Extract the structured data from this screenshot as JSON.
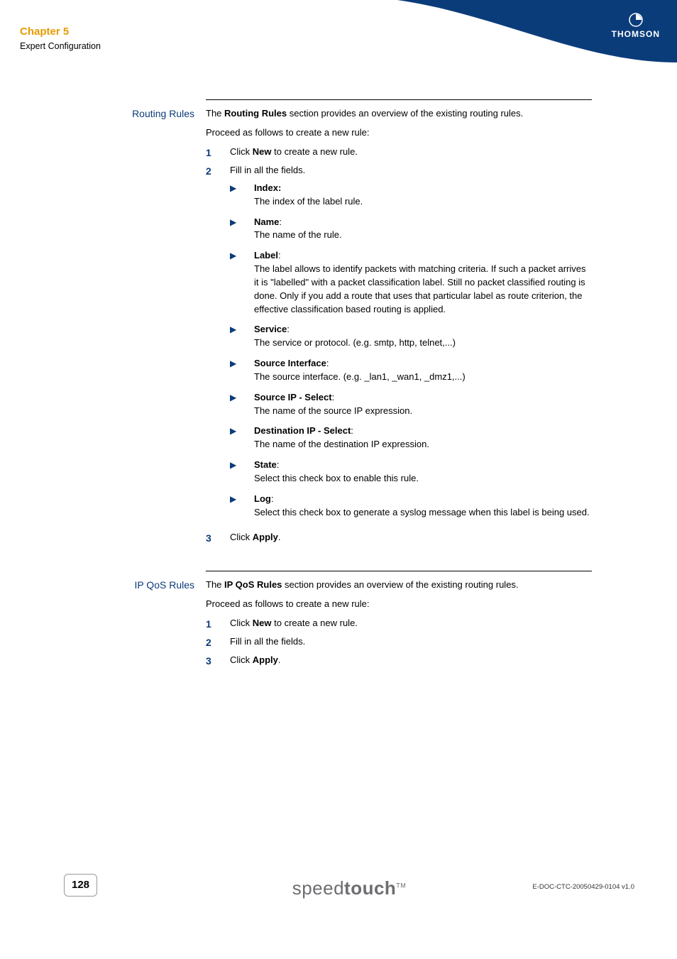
{
  "header": {
    "chapter": "Chapter 5",
    "subtitle": "Expert Configuration",
    "brand": "THOMSON"
  },
  "sections": {
    "routing": {
      "label": "Routing Rules",
      "intro_pre": "The ",
      "intro_bold": "Routing Rules",
      "intro_post": " section provides an overview of the existing routing rules.",
      "proceed": "Proceed as follows to create a new rule:",
      "steps": {
        "s1_pre": "Click ",
        "s1_bold": "New",
        "s1_post": " to create a new rule.",
        "s2": "Fill in all the fields.",
        "s3_pre": "Click ",
        "s3_bold": "Apply",
        "s3_post": "."
      },
      "fields": {
        "index": {
          "term": "Index:",
          "desc": "The index of the label rule."
        },
        "name": {
          "term": "Name",
          "desc": "The name of the rule."
        },
        "label": {
          "term": "Label",
          "desc": "The label allows to identify packets with matching criteria. If such a packet arrives it is \"labelled\" with a packet classification label. Still no packet classified routing is done. Only if you add a route that uses that particular label as route criterion, the effective classification based routing is applied."
        },
        "service": {
          "term": "Service",
          "desc": "The service or protocol. (e.g. smtp, http, telnet,...)"
        },
        "srcif": {
          "term": "Source Interface",
          "desc": "The source interface. (e.g. _lan1, _wan1, _dmz1,...)"
        },
        "srcip": {
          "term": "Source IP - Select",
          "desc": "The name of the source IP expression."
        },
        "dstip": {
          "term": "Destination IP - Select",
          "desc": "The name of the destination IP expression."
        },
        "state": {
          "term": "State",
          "desc": "Select this check box to enable this rule."
        },
        "log": {
          "term": "Log",
          "desc": "Select this check box to generate a syslog message when this label is being used."
        }
      }
    },
    "ipqos": {
      "label": "IP QoS Rules",
      "intro_pre": "The ",
      "intro_bold": "IP QoS Rules",
      "intro_post": " section provides an overview of the existing routing rules.",
      "proceed": "Proceed as follows to create a new rule:",
      "steps": {
        "s1_pre": "Click ",
        "s1_bold": "New",
        "s1_post": " to create a new rule.",
        "s2": "Fill in all the fields.",
        "s3_pre": "Click ",
        "s3_bold": "Apply",
        "s3_post": "."
      }
    }
  },
  "footer": {
    "page": "128",
    "product_light": "speed",
    "product_bold": "touch",
    "tm": "TM",
    "docref": "E-DOC-CTC-20050429-0104 v1.0"
  }
}
